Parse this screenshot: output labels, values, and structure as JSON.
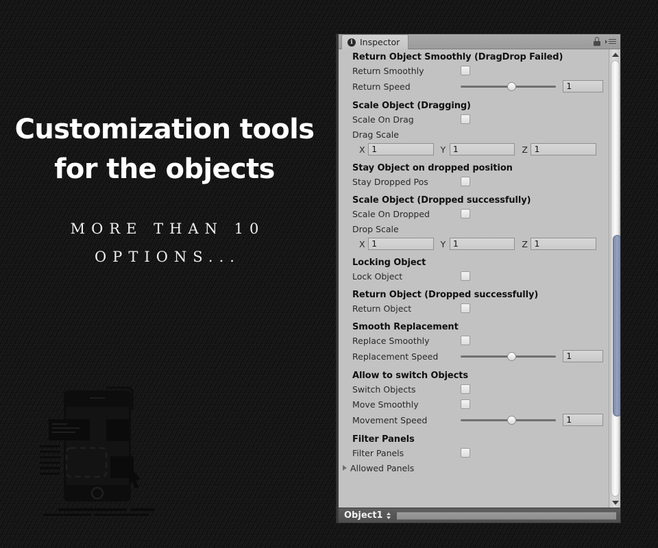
{
  "promo": {
    "title_line1": "Customization tools",
    "title_line2": "for the objects",
    "subtitle_line1": "MORE THAN 10",
    "subtitle_line2": "OPTIONS...",
    "title_color": "#ffffff",
    "background_color": "#161616"
  },
  "inspector": {
    "tab_label": "Inspector",
    "tab_icon": "info-icon",
    "lock_icon": "lock-icon",
    "menu_icon": "hamburger-menu-icon",
    "footer": {
      "object_name": "Object1",
      "stepper_icon": "up-down-stepper-icon"
    },
    "sections": [
      {
        "title": "Return Object Smoothly (DragDrop Failed)",
        "rows": [
          {
            "kind": "checkbox",
            "label": "Return Smoothly",
            "checked": false
          },
          {
            "kind": "slider",
            "label": "Return Speed",
            "value": "1",
            "knob_percent": 53
          }
        ]
      },
      {
        "title": "Scale Object (Dragging)",
        "rows": [
          {
            "kind": "checkbox",
            "label": "Scale On Drag",
            "checked": false
          },
          {
            "kind": "label",
            "label": "Drag Scale"
          },
          {
            "kind": "vector3",
            "x_label": "X",
            "x": "1",
            "y_label": "Y",
            "y": "1",
            "z_label": "Z",
            "z": "1"
          }
        ]
      },
      {
        "title": "Stay Object on dropped position",
        "rows": [
          {
            "kind": "checkbox",
            "label": "Stay Dropped Pos",
            "checked": false
          }
        ]
      },
      {
        "title": "Scale Object (Dropped successfully)",
        "rows": [
          {
            "kind": "checkbox",
            "label": "Scale On Dropped",
            "checked": false
          },
          {
            "kind": "label",
            "label": "Drop Scale"
          },
          {
            "kind": "vector3",
            "x_label": "X",
            "x": "1",
            "y_label": "Y",
            "y": "1",
            "z_label": "Z",
            "z": "1"
          }
        ]
      },
      {
        "title": "Locking Object",
        "rows": [
          {
            "kind": "checkbox",
            "label": "Lock Object",
            "checked": false
          }
        ]
      },
      {
        "title": "Return Object (Dropped successfully)",
        "rows": [
          {
            "kind": "checkbox",
            "label": "Return Object",
            "checked": false
          }
        ]
      },
      {
        "title": "Smooth Replacement",
        "rows": [
          {
            "kind": "checkbox",
            "label": "Replace Smoothly",
            "checked": false
          },
          {
            "kind": "slider",
            "label": "Replacement Speed",
            "value": "1",
            "knob_percent": 53
          }
        ]
      },
      {
        "title": "Allow to switch Objects",
        "rows": [
          {
            "kind": "checkbox",
            "label": "Switch Objects",
            "checked": false
          },
          {
            "kind": "checkbox",
            "label": "Move Smoothly",
            "checked": false
          },
          {
            "kind": "slider",
            "label": "Movement Speed",
            "value": "1",
            "knob_percent": 53
          }
        ]
      },
      {
        "title": "Filter Panels",
        "rows": [
          {
            "kind": "checkbox",
            "label": "Filter Panels",
            "checked": false
          },
          {
            "kind": "foldout",
            "label": "Allowed Panels",
            "expanded": false
          }
        ]
      }
    ],
    "scrollbar": {
      "up_arrow_icon": "triangle-up-icon",
      "down_arrow_icon": "triangle-down-icon",
      "thumb_top_percent": 38,
      "thumb_height_percent": 40
    }
  }
}
